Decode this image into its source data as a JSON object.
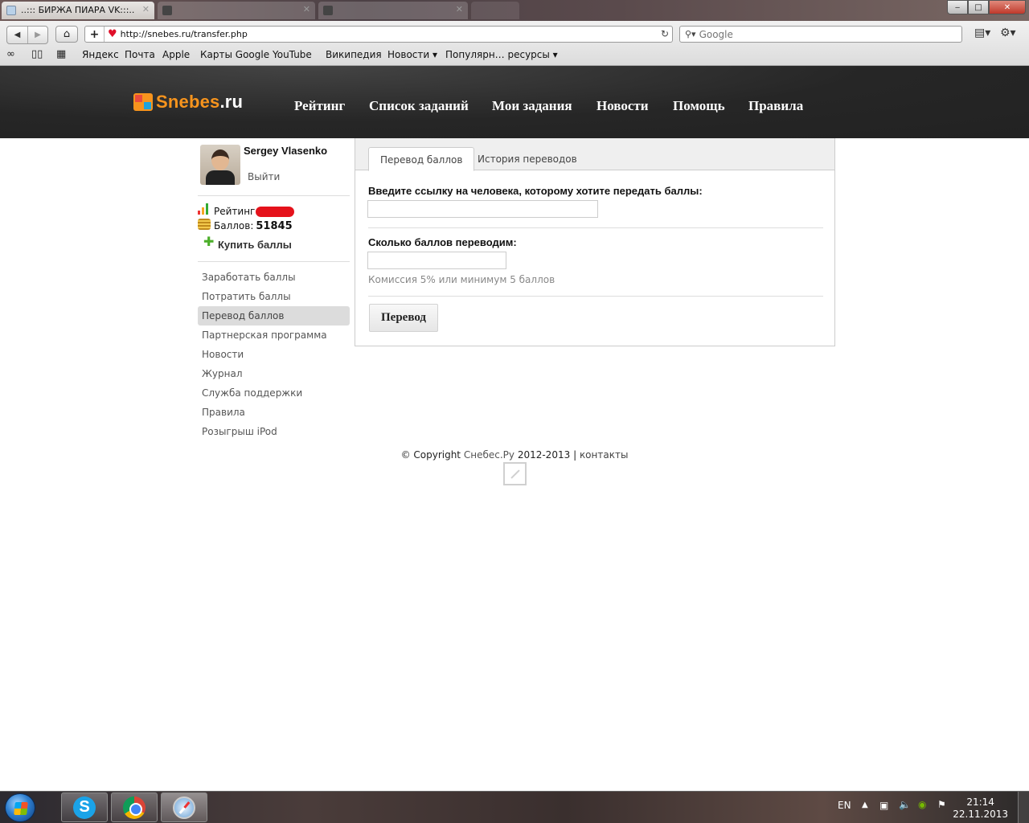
{
  "browser": {
    "tabs": [
      {
        "title": "..::: БИРЖА ПИАРА VK:::..",
        "active": true
      },
      {
        "title": "",
        "active": false
      },
      {
        "title": "",
        "active": false
      },
      {
        "title": "",
        "active": false
      }
    ],
    "window_buttons": {
      "minimize": "‒",
      "maximize": "□",
      "close": "✕"
    },
    "address": "http://snebes.ru/transfer.php",
    "search_placeholder": "Google",
    "bookmarks": [
      "Яндекс",
      "Почта",
      "Apple",
      "Карты Google",
      "YouTube",
      "Википедия",
      "Новости ▾",
      "Популярн… ресурсы ▾"
    ]
  },
  "site": {
    "logo_name": "Snebes",
    "logo_tld": ".ru",
    "nav": [
      "Рейтинг",
      "Список заданий",
      "Мои задания",
      "Новости",
      "Помощь",
      "Правила"
    ]
  },
  "sidebar": {
    "username": "Sergey Vlasenko",
    "logout": "Выйти",
    "rating_label": "Рейтинг:",
    "points_label": "Баллов:",
    "points_value": "51845",
    "buy_points": "Купить баллы",
    "menu": [
      {
        "label": "Заработать баллы",
        "active": false
      },
      {
        "label": "Потратить баллы",
        "active": false
      },
      {
        "label": "Перевод баллов",
        "active": true
      },
      {
        "label": "Партнерская программа",
        "active": false
      },
      {
        "label": "Новости",
        "active": false
      },
      {
        "label": "Журнал",
        "active": false
      },
      {
        "label": "Служба поддержки",
        "active": false
      },
      {
        "label": "Правила",
        "active": false
      },
      {
        "label": "Розыгрыш iPod",
        "active": false
      }
    ]
  },
  "main": {
    "tabs": [
      "Перевод баллов",
      "История переводов"
    ],
    "link_label": "Введите ссылку на человека, которому хотите передать баллы:",
    "link_value": "",
    "amount_label": "Сколько баллов переводим:",
    "amount_value": "",
    "commission_note": "Комиссия 5% или минимум 5 баллов",
    "submit_label": "Перевод"
  },
  "footer": {
    "copyright_prefix": "© Copyright",
    "brand": "Снебес.Ру",
    "years": "2012-2013",
    "separator": "|",
    "contacts": "контакты"
  },
  "taskbar": {
    "apps": [
      "skype",
      "chrome",
      "safari"
    ],
    "language": "EN",
    "time": "21:14",
    "date": "22.11.2013"
  },
  "colors": {
    "header_bg": "#262626",
    "logo_orange": "#f7941d",
    "active_menu_bg": "#dcdcdc",
    "rating_mask": "#e5121b"
  }
}
